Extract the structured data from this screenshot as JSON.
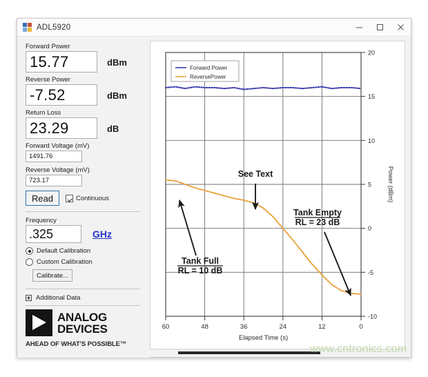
{
  "window": {
    "title": "ADL5920",
    "icon": "app-icon",
    "controls": {
      "minimize": "minimize-icon",
      "maximize": "maximize-icon",
      "close": "close-icon"
    }
  },
  "panel": {
    "forward_power": {
      "label": "Forward Power",
      "value": "15.77",
      "unit": "dBm"
    },
    "reverse_power": {
      "label": "Reverse Power",
      "value": "-7.52",
      "unit": "dBm"
    },
    "return_loss": {
      "label": "Return Loss",
      "value": "23.29",
      "unit": "dB"
    },
    "forward_voltage": {
      "label": "Forward Voltage (mV)",
      "value": "1491.76"
    },
    "reverse_voltage": {
      "label": "Reverse Voltage (mV)",
      "value": "723.17"
    },
    "read_button": "Read",
    "continuous": {
      "label": "Continuous",
      "checked": true
    },
    "frequency": {
      "label": "Frequency",
      "value": ".325",
      "unit_link": "GHz"
    },
    "calibration": {
      "default_option": "Default Calibration",
      "custom_option": "Custom Calibration",
      "selected": "Default Calibration",
      "calibrate_button": "Calibrate..."
    },
    "additional_data": {
      "label": "Additional Data",
      "expander_icon": "plus-box-icon"
    },
    "logo": {
      "mark_icon": "analog-devices-triangle-icon",
      "line1": "ANALOG",
      "line2": "DEVICES",
      "tagline": "AHEAD OF WHAT'S POSSIBLE™"
    }
  },
  "watermark": "www.cntronics.com",
  "chart_data": {
    "type": "line",
    "title": "",
    "xlabel": "Elapsed Time (s)",
    "ylabel": "Power (dBm)",
    "xticks": [
      60,
      48,
      36,
      24,
      12,
      0
    ],
    "yticks": [
      20,
      15,
      10,
      5,
      0,
      -5,
      -10
    ],
    "xlim": [
      60,
      0
    ],
    "ylim": [
      -10,
      20
    ],
    "x_axis_reversed": true,
    "grid": true,
    "legend_position": "top-left",
    "legend": [
      "Forward Power",
      "ReversePower"
    ],
    "colors": {
      "forward": "#3a3ab0",
      "reverse": "#e8a33d"
    },
    "x": [
      60,
      57,
      54,
      51,
      48,
      45,
      42,
      39,
      36,
      33,
      30,
      27,
      24,
      21,
      18,
      15,
      12,
      9,
      6,
      3,
      0
    ],
    "series": [
      {
        "name": "Forward Power",
        "color": "#3a3ab0",
        "style": "dotted",
        "values": [
          16.0,
          16.1,
          15.9,
          16.1,
          16.0,
          16.0,
          15.9,
          16.0,
          15.8,
          15.9,
          16.0,
          15.9,
          16.0,
          16.0,
          15.9,
          16.0,
          16.1,
          15.9,
          16.0,
          16.0,
          15.9
        ]
      },
      {
        "name": "ReversePower",
        "color": "#e8a33d",
        "style": "dotted",
        "values": [
          5.5,
          5.4,
          5.0,
          4.6,
          4.3,
          4.0,
          3.7,
          3.4,
          3.2,
          2.9,
          2.3,
          1.3,
          0.0,
          -1.3,
          -2.7,
          -4.1,
          -5.3,
          -6.4,
          -7.1,
          -7.4,
          -7.5
        ]
      }
    ],
    "annotations": [
      {
        "id": "see-text",
        "lines": [
          "See Text"
        ],
        "underline_first": false
      },
      {
        "id": "tank-full",
        "lines": [
          "Tank Full",
          "RL = 10 dB"
        ],
        "underline_first": true
      },
      {
        "id": "tank-empty",
        "lines": [
          "Tank Empty",
          "RL = 23 dB"
        ],
        "underline_first": true
      }
    ]
  }
}
